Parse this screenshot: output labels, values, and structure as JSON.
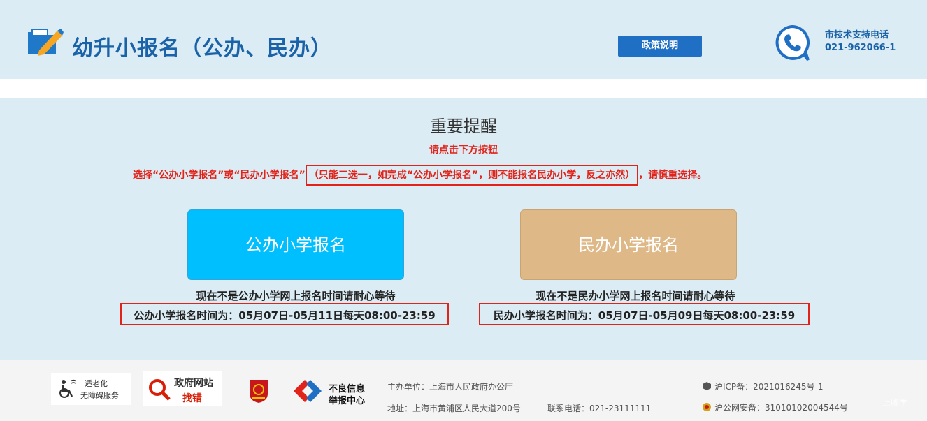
{
  "header": {
    "title": "幼升小报名（公办、民办）",
    "policy_button": "政策说明",
    "support_label": "市技术支持电话",
    "support_phone": "021-962066-1"
  },
  "notice": {
    "title": "重要提醒",
    "hint_line1": "请点击下方按钮",
    "hint_line2_before": "选择“公办小学报名”或“民办小学报名”",
    "hint_line2_boxed": "（只能二选一，如完成“公办小学报名”，则不能报名民办小学，反之亦然）",
    "hint_line2_after": "，请慎重选择。"
  },
  "public": {
    "button": "公办小学报名",
    "wait_text": "现在不是公办小学网上报名时间请耐心等待",
    "time_text": "公办小学报名时间为：05月07日-05月11日每天08:00-23:59"
  },
  "private": {
    "button": "民办小学报名",
    "wait_text": "现在不是民办小学网上报名时间请耐心等待",
    "time_text": "民办小学报名时间为：05月07日-05月09日每天08:00-23:59"
  },
  "footer": {
    "accessibility": [
      "适老化",
      "无障碍服务"
    ],
    "gov_error": [
      "政府网站",
      "找错"
    ],
    "report": [
      "不良信息",
      "举报中心"
    ],
    "host": "主办单位：上海市人民政府办公厅",
    "address": "地址：上海市黄浦区人民大道200号",
    "contact": "联系电话：021-23111111",
    "icp": "沪ICP备：2021016245号-1",
    "police": "沪公网安备：31010102004544号",
    "watermark": "上脚学"
  },
  "colors": {
    "brand_blue": "#1a63a8",
    "alert_red": "#e2231a",
    "public_btn": "#00bfff",
    "private_btn": "#deb887"
  }
}
